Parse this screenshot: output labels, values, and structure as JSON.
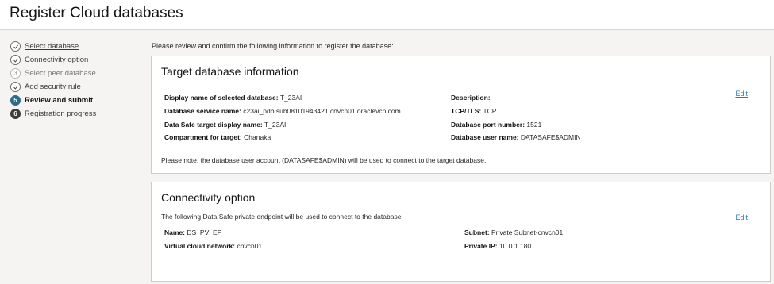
{
  "header": {
    "title": "Register Cloud databases"
  },
  "steps": [
    {
      "num": "",
      "label": "Select database",
      "state": "done"
    },
    {
      "num": "",
      "label": "Connectivity option",
      "state": "done"
    },
    {
      "num": "3",
      "label": "Select peer database",
      "state": "skipped"
    },
    {
      "num": "",
      "label": "Add security rule",
      "state": "done"
    },
    {
      "num": "5",
      "label": "Review and submit",
      "state": "current"
    },
    {
      "num": "6",
      "label": "Registration progress",
      "state": "upcoming"
    }
  ],
  "intro": "Please review and confirm the following information to register the database:",
  "target": {
    "title": "Target database information",
    "edit": "Edit",
    "display_name": {
      "label": "Display name of selected database:",
      "value": "T_23AI"
    },
    "service_name": {
      "label": "Database service name:",
      "value": "c23ai_pdb.sub08101943421.cnvcn01.oraclevcn.com"
    },
    "ds_display_name": {
      "label": "Data Safe target display name:",
      "value": "T_23AI"
    },
    "compartment": {
      "label": "Compartment for target:",
      "value": "Chanaka"
    },
    "description": {
      "label": "Description:",
      "value": ""
    },
    "tcp_tls": {
      "label": "TCP/TLS:",
      "value": "TCP"
    },
    "port": {
      "label": "Database port number:",
      "value": "1521"
    },
    "user": {
      "label": "Database user name:",
      "value": "DATASAFE$ADMIN"
    },
    "note": "Please note, the database user account (DATASAFE$ADMIN) will be used to connect to the target database."
  },
  "connectivity": {
    "title": "Connectivity option",
    "edit": "Edit",
    "note": "The following Data Safe private endpoint will be used to connect to the database:",
    "name": {
      "label": "Name:",
      "value": "DS_PV_EP"
    },
    "vcn": {
      "label": "Virtual cloud network:",
      "value": "cnvcn01"
    },
    "subnet": {
      "label": "Subnet:",
      "value": "Private Subnet-cnvcn01"
    },
    "private_ip": {
      "label": "Private IP:",
      "value": "10.0.1.180"
    }
  }
}
